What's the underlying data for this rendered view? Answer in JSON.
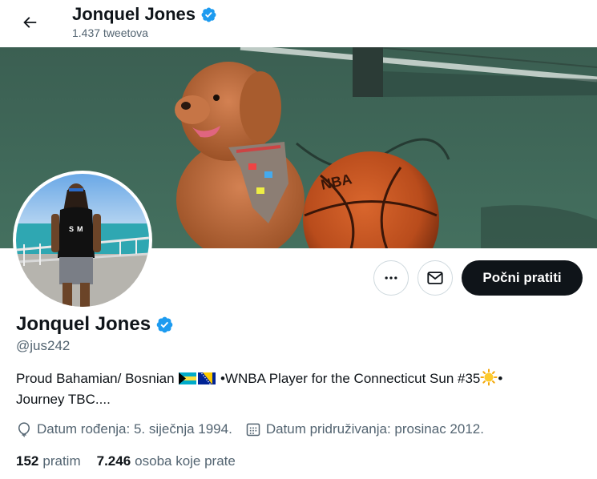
{
  "header": {
    "name": "Jonquel Jones",
    "tweet_count": "1.437 tweetova"
  },
  "profile": {
    "name": "Jonquel Jones",
    "handle": "@jus242",
    "verified": true,
    "bio_part1": "Proud Bahamian/ Bosnian ",
    "bio_part2": " •WNBA Player for the Connecticut Sun #35",
    "bio_part3": "•",
    "bio_line2": "Journey TBC....",
    "birthday": "Datum rođenja: 5. siječnja 1994.",
    "joined": "Datum pridruživanja: prosinac 2012."
  },
  "actions": {
    "follow_label": "Počni pratiti"
  },
  "stats": {
    "following_count": "152",
    "following_label": "pratim",
    "followers_count": "7.246",
    "followers_label": "osoba koje prate"
  },
  "colors": {
    "verified": "#1d9bf0",
    "follow_bg": "#0f1419",
    "secondary_text": "#536471"
  },
  "icons": {
    "back": "arrow-left-icon",
    "verified": "verified-badge-icon",
    "more": "more-dots-icon",
    "message": "envelope-icon",
    "birthday": "balloon-icon",
    "joined": "calendar-icon",
    "flag1": "bahamas-flag",
    "flag2": "bosnia-flag",
    "emoji": "sun-emoji"
  }
}
